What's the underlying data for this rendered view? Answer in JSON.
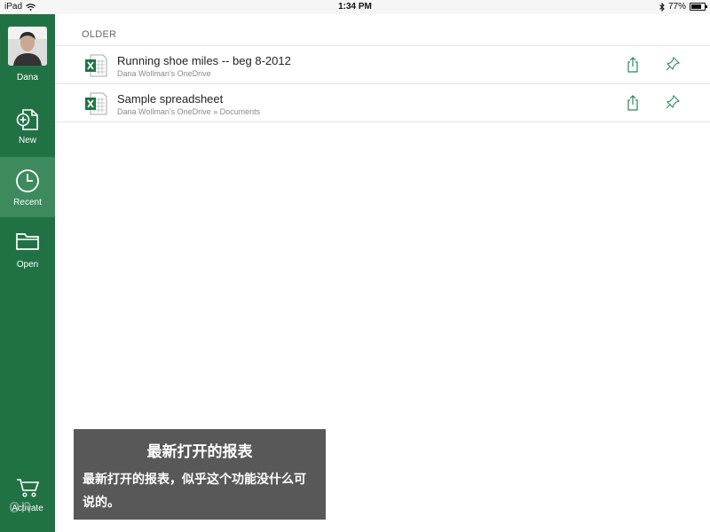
{
  "statusbar": {
    "device": "iPad",
    "time": "1:34 PM",
    "battery_text": "77%",
    "battery_level": 0.77
  },
  "sidebar": {
    "user_name": "Dana",
    "items": [
      {
        "label": "New",
        "icon": "new-file-icon"
      },
      {
        "label": "Recent",
        "icon": "clock-icon",
        "active": true
      },
      {
        "label": "Open",
        "icon": "folder-icon"
      }
    ],
    "activate_label": "Activate"
  },
  "main": {
    "section_title": "OLDER",
    "files": [
      {
        "name": "Running shoe miles -- beg 8-2012",
        "path": "Dana Wollman's OneDrive",
        "icon": "excel-file-icon"
      },
      {
        "name": "Sample spreadsheet",
        "path": "Dana Wollman's OneDrive » Documents",
        "icon": "excel-file-icon"
      }
    ]
  },
  "caption": {
    "title": "最新打开的报表",
    "body": "最新打开的报表，似乎这个功能没什么可说的。"
  },
  "watermark": "on",
  "colors": {
    "sidebar": "#207245",
    "active": "#3d8a5e",
    "accent_green": "#2a8a55"
  }
}
